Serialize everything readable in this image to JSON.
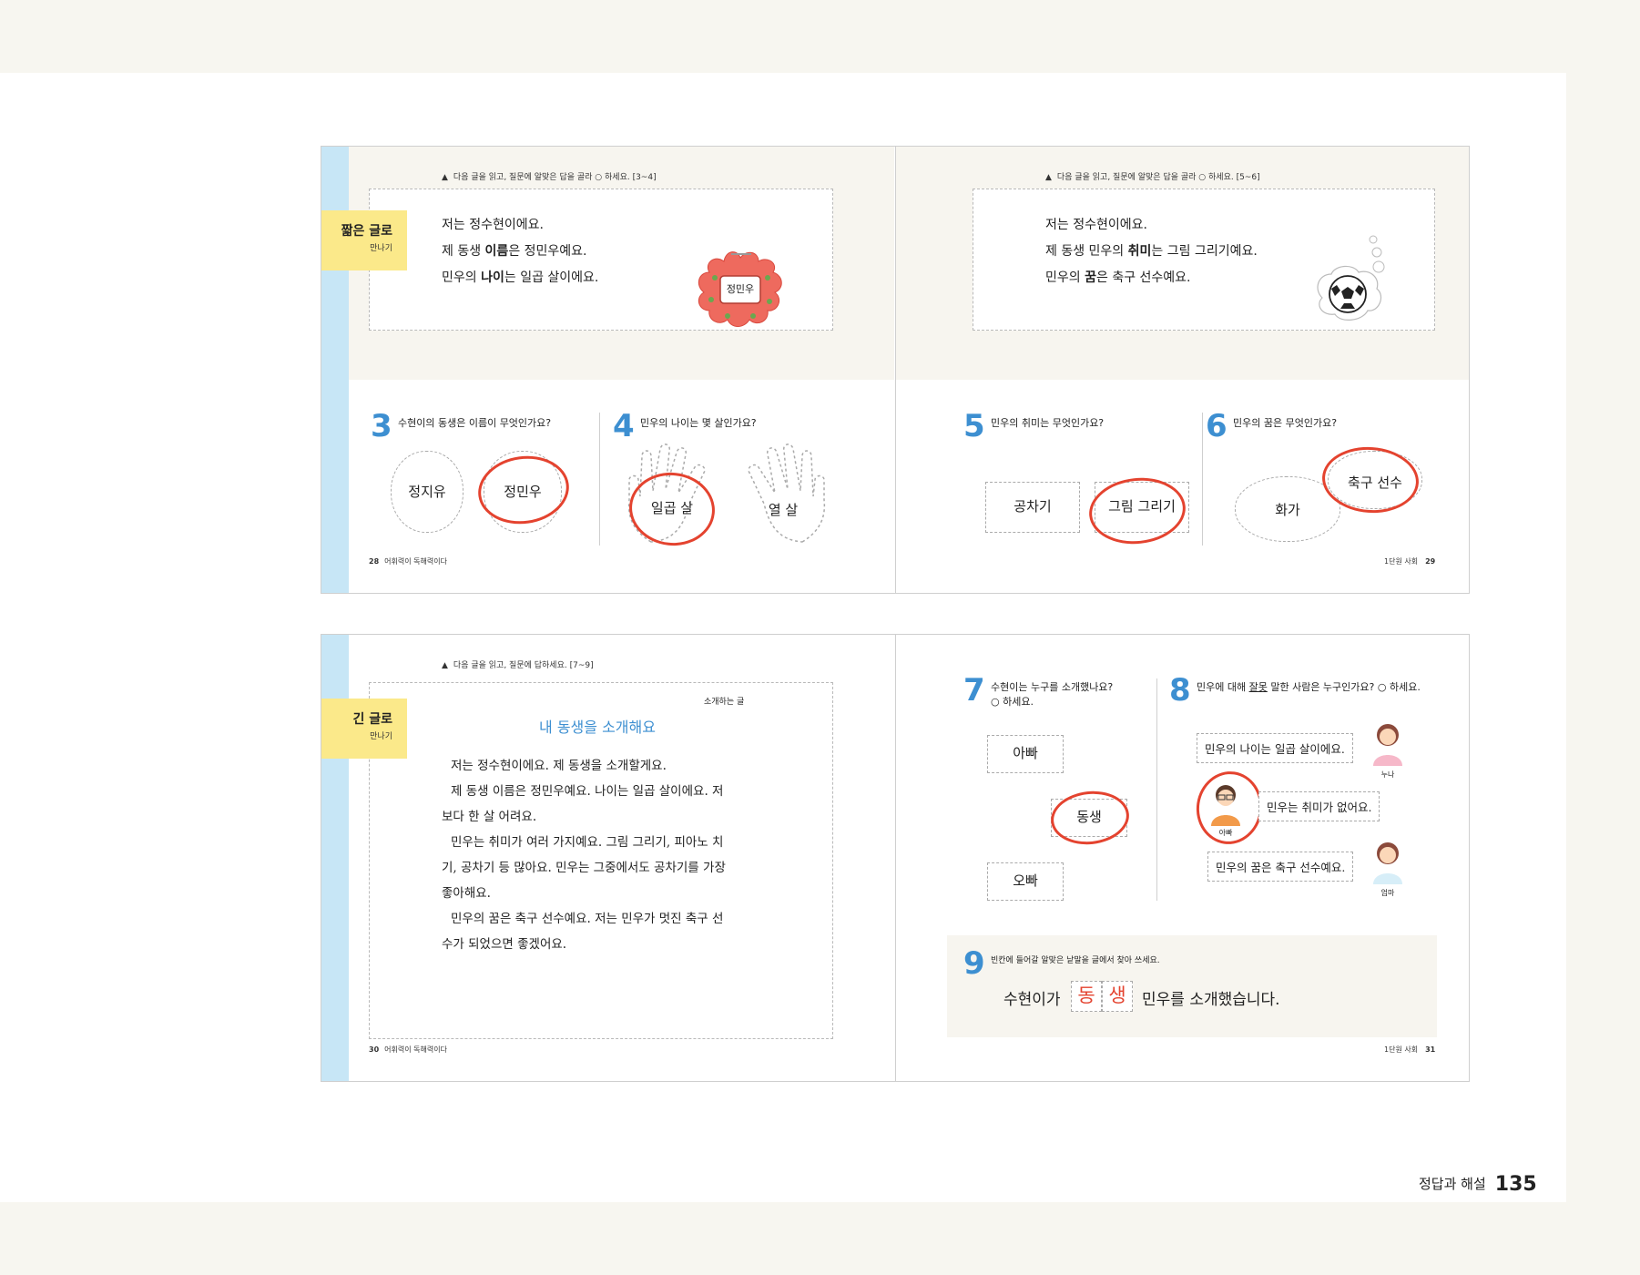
{
  "spread1": {
    "left": {
      "instruction": "다음 글을 읽고, 질문에 알맞은 답을 골라 ○ 하세요. [3~4]",
      "tag_main": "짧은 글로",
      "tag_sub": "만나기",
      "passage": [
        {
          "pre": "저는 정수현이에요.",
          "bold": "",
          "post": ""
        },
        {
          "pre": "제 동생 ",
          "bold": "이름",
          "post": "은 정민우예요."
        },
        {
          "pre": "민우의 ",
          "bold": "나이",
          "post": "는 일곱 살이에요."
        }
      ],
      "nametag_text": "정민우",
      "q3": {
        "num": "3",
        "text": "수현이의 동생은 이름이 무엇인가요?",
        "options": [
          "정지유",
          "정민우"
        ],
        "answer": "정민우"
      },
      "q4": {
        "num": "4",
        "text": "민우의 나이는 몇 살인가요?",
        "options": [
          "일곱 살",
          "열 살"
        ],
        "answer": "일곱 살"
      },
      "footer_page": "28",
      "footer_book": "어휘력이 독해력이다"
    },
    "right": {
      "instruction": "다음 글을 읽고, 질문에 알맞은 답을 골라 ○ 하세요. [5~6]",
      "passage": [
        {
          "pre": "저는 정수현이에요.",
          "bold": "",
          "post": ""
        },
        {
          "pre": "제 동생 민우의 ",
          "bold": "취미",
          "post": "는 그림 그리기예요."
        },
        {
          "pre": "민우의 ",
          "bold": "꿈",
          "post": "은 축구 선수예요."
        }
      ],
      "q5": {
        "num": "5",
        "text": "민우의 취미는 무엇인가요?",
        "options": [
          "공차기",
          "그림 그리기"
        ],
        "answer": "그림 그리기"
      },
      "q6": {
        "num": "6",
        "text": "민우의 꿈은 무엇인가요?",
        "options": [
          "화가",
          "축구 선수"
        ],
        "answer": "축구 선수"
      },
      "footer_unit": "1단원 사회",
      "footer_page": "29"
    }
  },
  "spread2": {
    "left": {
      "instruction": "다음 글을 읽고, 질문에 답하세요. [7~9]",
      "tag_main": "긴 글로",
      "tag_sub": "만나기",
      "genre": "소개하는 글",
      "title": "내 동생을 소개해요",
      "passage": [
        "저는 정수현이에요. 제 동생을 소개할게요.",
        "제 동생 이름은 정민우예요. 나이는 일곱 살이에요. 저",
        "보다 한 살 어려요.",
        "민우는 취미가 여러 가지예요. 그림 그리기, 피아노 치",
        "기, 공차기 등 많아요. 민우는 그중에서도 공차기를 가장",
        "좋아해요.",
        "민우의 꿈은 축구 선수예요. 저는 민우가 멋진 축구 선",
        "수가 되었으면 좋겠어요."
      ],
      "footer_page": "30",
      "footer_book": "어휘력이 독해력이다"
    },
    "right": {
      "q7": {
        "num": "7",
        "text1": "수현이는 누구를 소개했나요?",
        "text2": "○ 하세요.",
        "options": [
          "아빠",
          "동생",
          "오빠"
        ],
        "answer": "동생"
      },
      "q8": {
        "num": "8",
        "text_pre": "민우에 대해 ",
        "text_underline": "잘못",
        "text_post": " 말한 사람은 누구인가요? ○ 하세요.",
        "speakers": [
          {
            "name": "누나",
            "line": "민우의 나이는 일곱 살이에요."
          },
          {
            "name": "아빠",
            "line": "민우는 취미가 없어요."
          },
          {
            "name": "엄마",
            "line": "민우의 꿈은 축구 선수예요."
          }
        ],
        "answer": "아빠"
      },
      "q9": {
        "num": "9",
        "text": "빈칸에 들어갈 알맞은 낱말을 글에서 찾아 쓰세요.",
        "sentence_pre": "수현이가",
        "blank1": "동",
        "blank2": "생",
        "sentence_post": "민우를 소개했습니다."
      },
      "footer_unit": "1단원 사회",
      "footer_page": "31"
    }
  },
  "answer_key": {
    "label": "정답과 해설",
    "page": "135"
  },
  "colors": {
    "accent_blue": "#3d8fd1",
    "answer_red": "#e4432f",
    "tag_yellow": "#fbe98a",
    "sidebar_blue": "#c7e6f6"
  }
}
